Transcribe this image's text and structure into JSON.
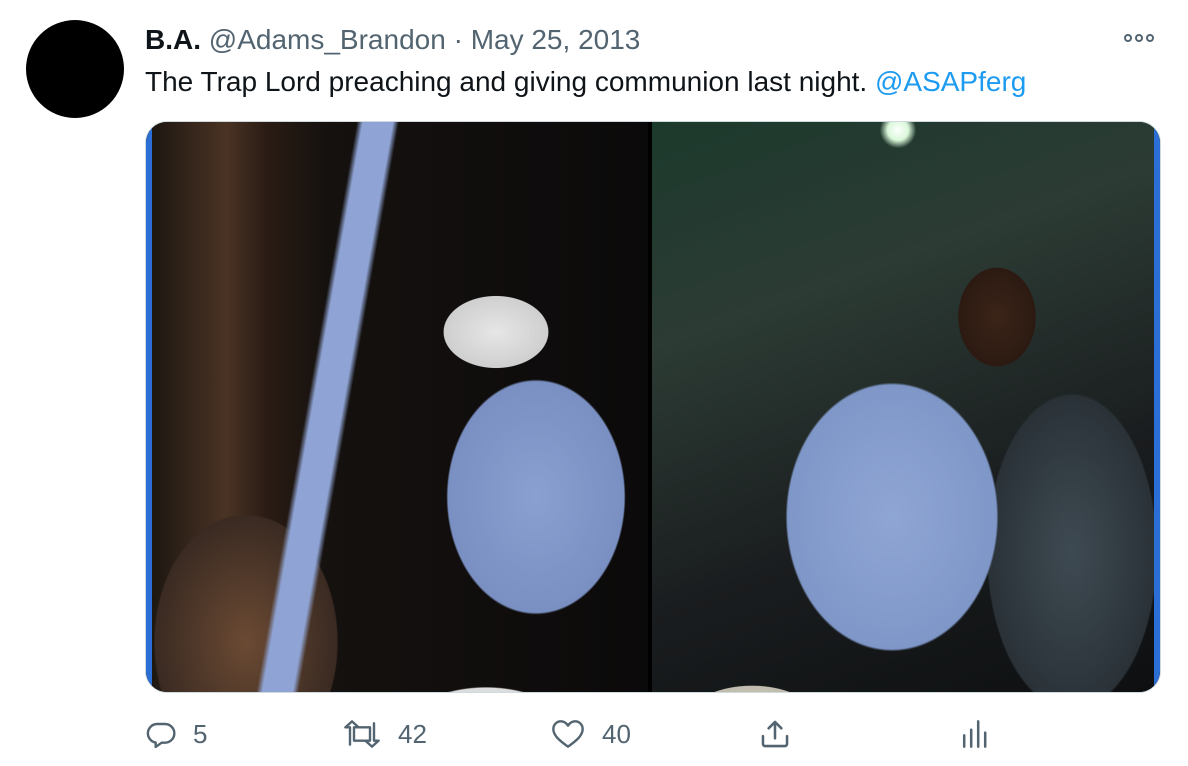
{
  "tweet": {
    "name": "B.A.",
    "handle": "@Adams_Brandon",
    "separator": "·",
    "date": "May 25, 2013",
    "text": "The Trap Lord preaching and giving communion last night.",
    "mention": "@ASAPferg",
    "more_icon": "more-icon"
  },
  "media": {
    "image_count": 2
  },
  "actions": {
    "reply": {
      "icon": "reply-icon",
      "count": "5"
    },
    "retweet": {
      "icon": "retweet-icon",
      "count": "42"
    },
    "like": {
      "icon": "heart-icon",
      "count": "40"
    },
    "share": {
      "icon": "share-icon"
    },
    "analytics": {
      "icon": "analytics-icon"
    }
  },
  "colors": {
    "text": "#0f1419",
    "secondary": "#536471",
    "accent": "#1d9bf0",
    "border": "#cfd9de"
  }
}
